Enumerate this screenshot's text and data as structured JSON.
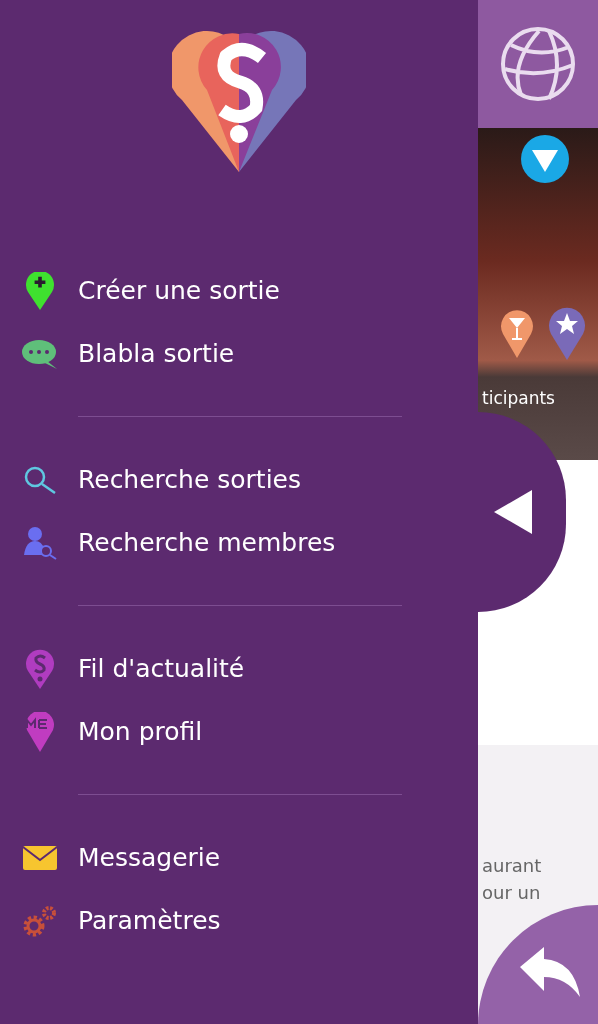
{
  "drawer": {
    "groups": [
      {
        "items": [
          {
            "kind": "create",
            "label": "Créer une sortie"
          },
          {
            "kind": "chat",
            "label": "Blabla sortie"
          }
        ]
      },
      {
        "items": [
          {
            "kind": "search",
            "label": "Recherche sorties"
          },
          {
            "kind": "members",
            "label": "Recherche membres"
          }
        ]
      },
      {
        "items": [
          {
            "kind": "feed",
            "label": "Fil d'actualité"
          },
          {
            "kind": "profile",
            "label": "Mon profil"
          }
        ]
      },
      {
        "items": [
          {
            "kind": "mail",
            "label": "Messagerie"
          },
          {
            "kind": "settings",
            "label": "Paramètres"
          }
        ]
      }
    ]
  },
  "background": {
    "photo_caption": "ticipants",
    "text_lines": [
      "aurant",
      "our un"
    ]
  }
}
